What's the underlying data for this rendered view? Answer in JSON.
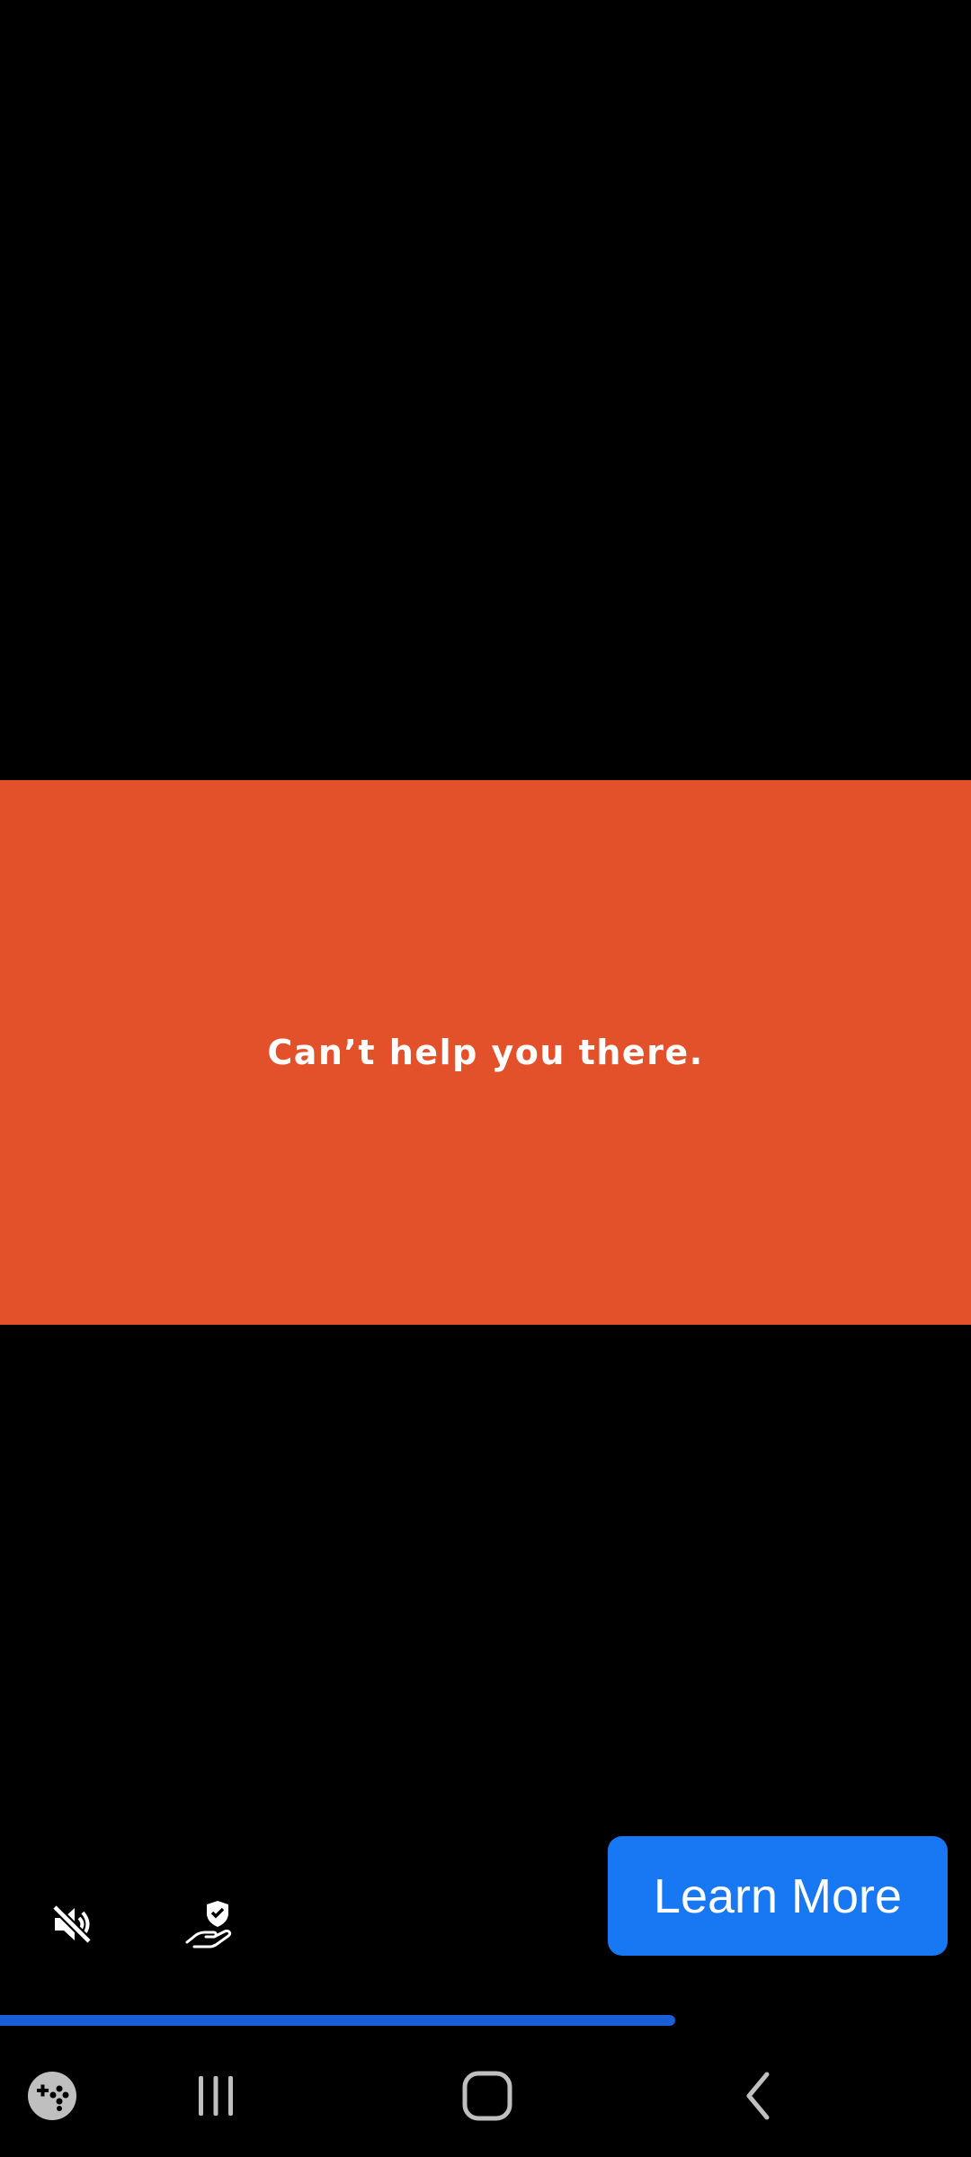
{
  "ad": {
    "headline": "Can’t help you there.",
    "banner_color": "#E3512A",
    "cta_label": "Learn More",
    "cta_color": "#1877F2"
  },
  "controls": {
    "mute_icon": "speaker-muted-icon",
    "adchoices_icon": "hand-shield-icon"
  },
  "progress": {
    "value": 0.695,
    "color": "#1A5FD6"
  },
  "navbar": {
    "game_icon": "game-launcher-icon",
    "recents_icon": "recent-apps-icon",
    "home_icon": "home-icon",
    "back_icon": "back-icon"
  }
}
